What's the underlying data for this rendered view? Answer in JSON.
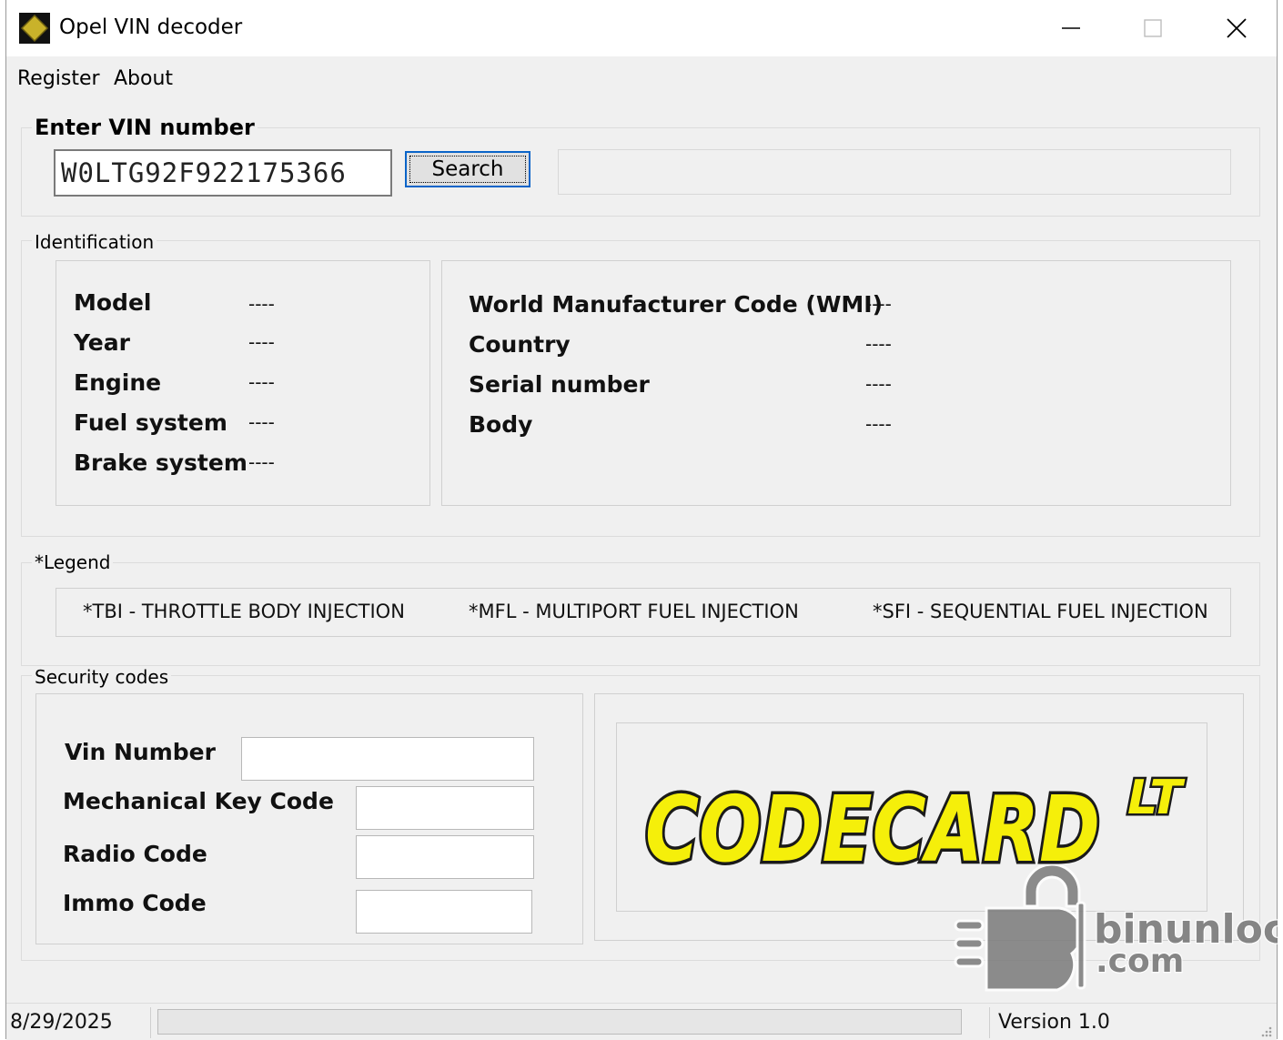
{
  "window": {
    "title": "Opel VIN decoder"
  },
  "menu": {
    "items": [
      "Register",
      "About"
    ]
  },
  "vin_group": {
    "label": "Enter VIN number",
    "vin_value": "W0LTG92F922175366",
    "search_label": "Search",
    "result_text": ""
  },
  "identification": {
    "label": "Identification",
    "left_fields": [
      {
        "label": "Model",
        "value": "----"
      },
      {
        "label": "Year",
        "value": "----"
      },
      {
        "label": "Engine",
        "value": "----"
      },
      {
        "label": "Fuel system",
        "value": "----"
      },
      {
        "label": "Brake system",
        "value": "----"
      }
    ],
    "right_fields": [
      {
        "label": "World Manufacturer Code (WMI)",
        "value": "----"
      },
      {
        "label": "Country",
        "value": "----"
      },
      {
        "label": "Serial number",
        "value": "----"
      },
      {
        "label": "Body",
        "value": "----"
      }
    ]
  },
  "legend": {
    "label": "*Legend",
    "items": [
      "*TBI - THROTTLE BODY INJECTION",
      "*MFL  - MULTIPORT FUEL INJECTION",
      "*SFI - SEQUENTIAL FUEL INJECTION"
    ]
  },
  "security": {
    "label": "Security codes",
    "fields": [
      {
        "label": "Vin Number",
        "value": ""
      },
      {
        "label": "Mechanical Key Code",
        "value": ""
      },
      {
        "label": "Radio Code",
        "value": ""
      },
      {
        "label": "Immo Code",
        "value": ""
      }
    ]
  },
  "logo": {
    "text": "CODECARD",
    "suffix": "LT",
    "fill": "#f5ef0a",
    "stroke": "#1a1a1a"
  },
  "watermark": {
    "line1": "binunlock",
    "line2": ".com"
  },
  "status": {
    "date": "8/29/2025",
    "progress": 0,
    "version": "Version 1.0"
  },
  "icons": [
    "app-icon",
    "minimize-icon",
    "maximize-icon",
    "close-icon",
    "size-grip-icon"
  ]
}
